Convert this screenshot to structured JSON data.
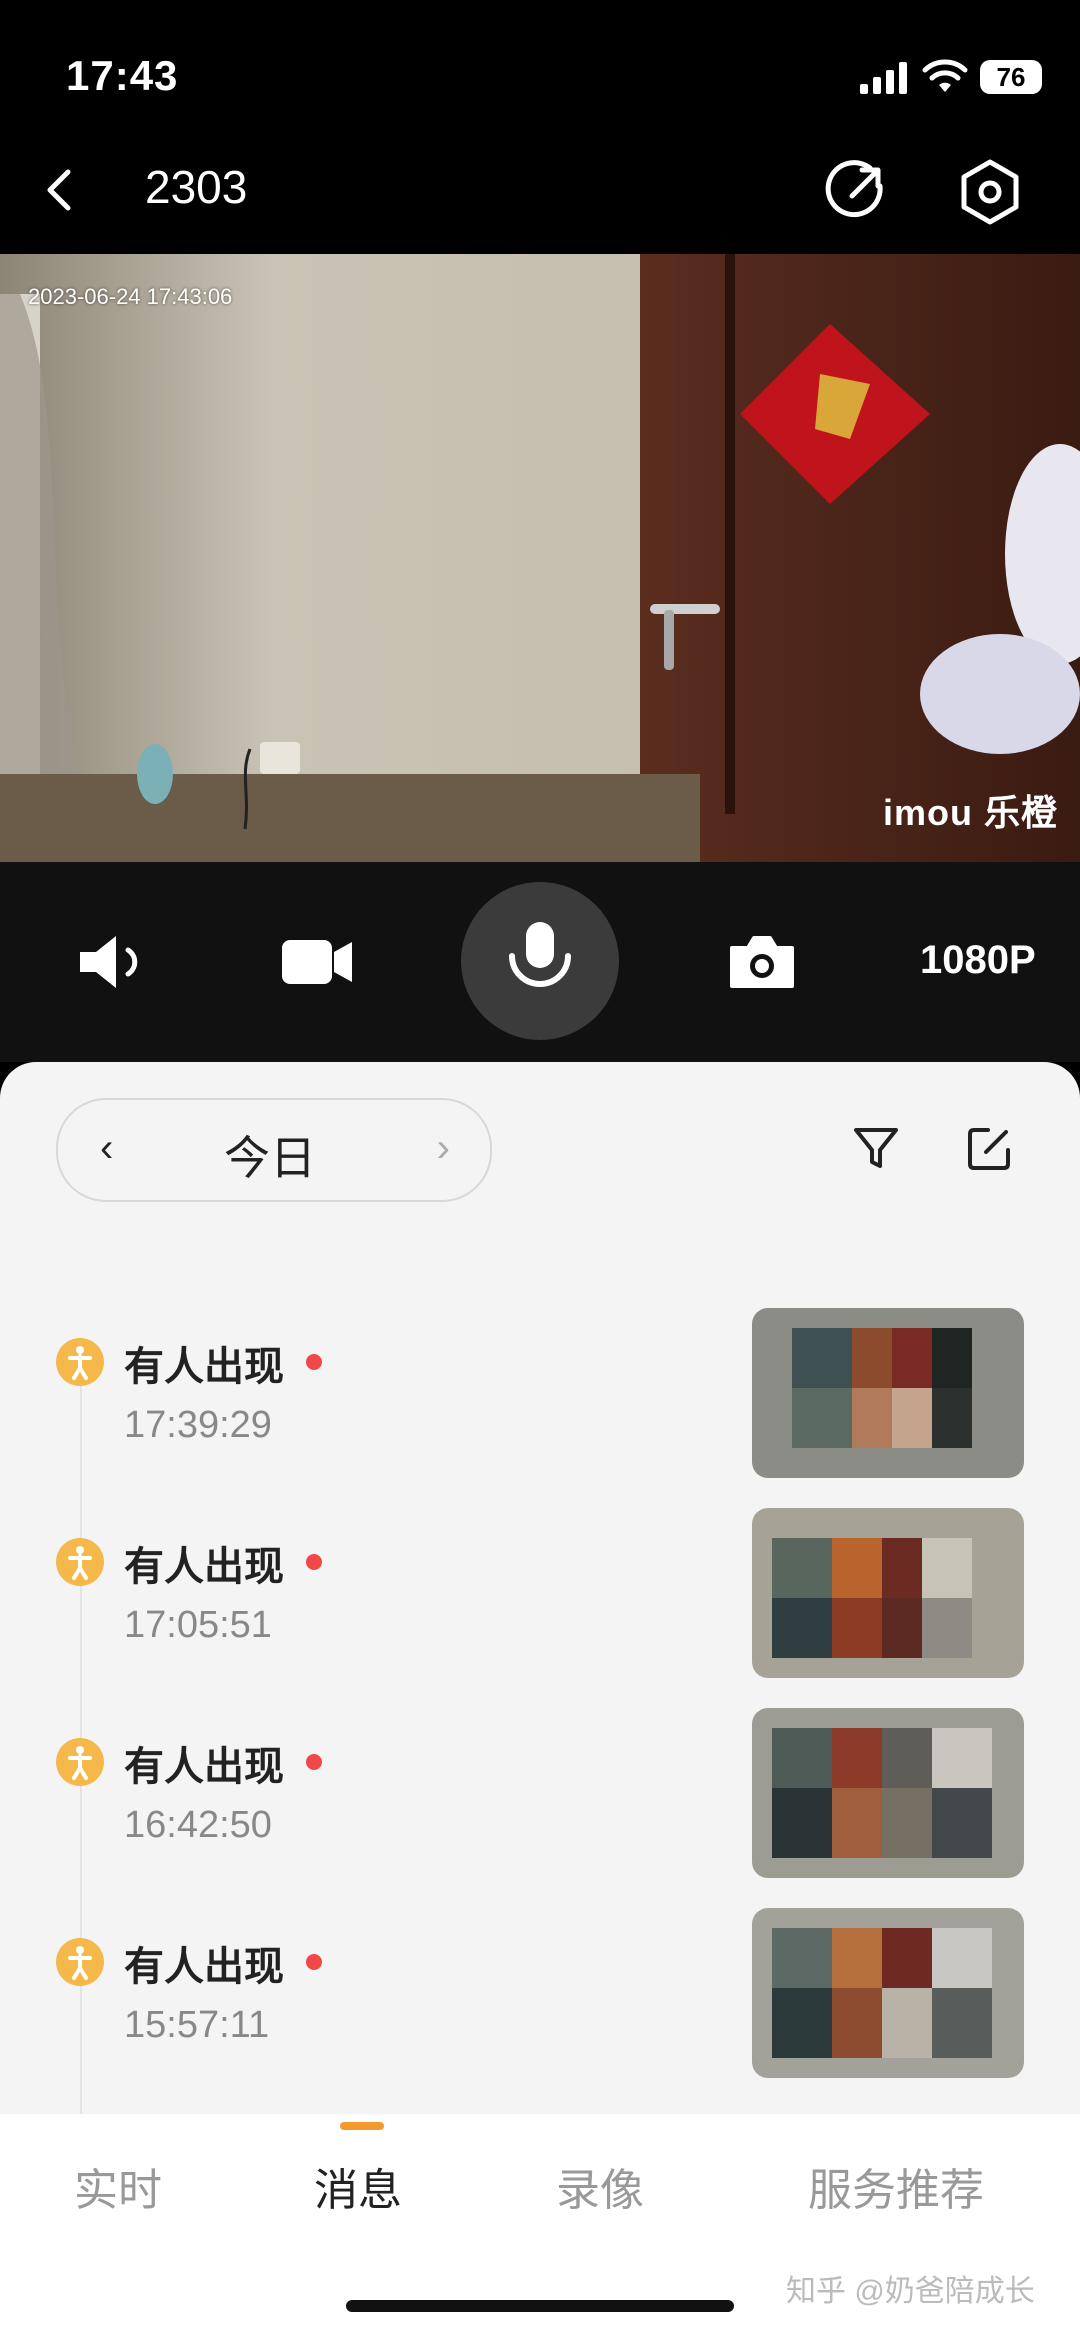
{
  "status_bar": {
    "time": "17:43",
    "battery": "76"
  },
  "nav": {
    "title": "2303",
    "icons": [
      "back-icon",
      "share-icon",
      "settings-icon"
    ]
  },
  "video": {
    "timestamp": "2023-06-24 17:43:06",
    "logo": "imou 乐橙"
  },
  "controls": {
    "resolution": "1080P",
    "icons": [
      "speaker-icon",
      "record-icon",
      "microphone-icon",
      "camera-icon"
    ]
  },
  "date_selector": {
    "prev": "‹",
    "label": "今日",
    "next": "›"
  },
  "events": [
    {
      "title": "有人出现",
      "time": "17:39:29"
    },
    {
      "title": "有人出现",
      "time": "17:05:51"
    },
    {
      "title": "有人出现",
      "time": "16:42:50"
    },
    {
      "title": "有人出现",
      "time": "15:57:11"
    }
  ],
  "tabs": [
    {
      "label": "实时",
      "active": false
    },
    {
      "label": "消息",
      "active": true
    },
    {
      "label": "录像",
      "active": false
    },
    {
      "label": "服务推荐",
      "active": false
    }
  ],
  "watermark": "知乎 @奶爸陪成长",
  "colors": {
    "accent": "#f29a2e",
    "badge": "#f5b84a",
    "unread_dot": "#f04848"
  }
}
